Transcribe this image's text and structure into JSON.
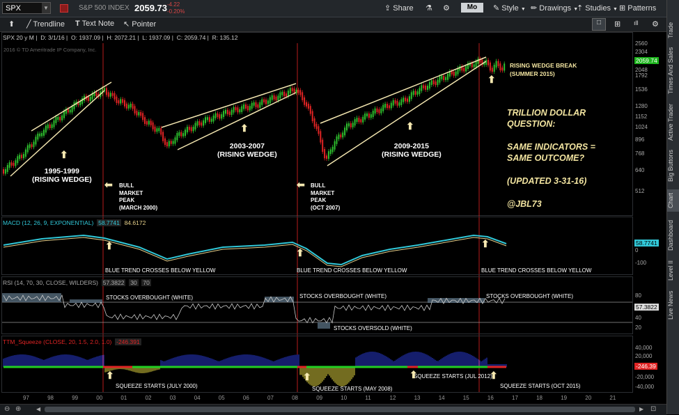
{
  "topbar": {
    "symbol": "SPX",
    "index_name": "S&P 500 INDEX",
    "price": "2059.73",
    "change": "-4.22",
    "change_pct": "-0.20%",
    "share": "Share",
    "period": "Mo",
    "style": "Style",
    "drawings": "Drawings",
    "studies": "Studies",
    "patterns": "Patterns"
  },
  "toolbar2": {
    "trendline": "Trendline",
    "text_note": "Text Note",
    "pointer": "Pointer"
  },
  "chart_header": {
    "title": "SPX 20 y M",
    "date": "D: 3/1/16",
    "open": "O: 1937.09",
    "high": "H: 2072.21",
    "low": "L: 1937.09",
    "close": "C: 2059.74",
    "range": "R: 135.12",
    "copyright": "2016 © TD Ameritrade IP Company, Inc."
  },
  "price_axis": [
    "2560",
    "2304",
    "2048",
    "1792",
    "1536",
    "1280",
    "1152",
    "1024",
    "896",
    "768",
    "640",
    "512"
  ],
  "price_badge": "2059.74",
  "annotations": {
    "wedge1": "1995-1999\n(RISING WEDGE)",
    "wedge2": "2003-2007\n(RISING WEDGE)",
    "wedge3": "2009-2015\n(RISING WEDGE)",
    "peak1": "BULL\nMARKET\nPEAK\n(MARCH 2000)",
    "peak2": "BULL\nMARKET\nPEAK\n(OCT 2007)",
    "break": "RISING WEDGE BREAK\n(SUMMER 2015)",
    "q1": "TRILLION DOLLAR",
    "q2": "QUESTION:",
    "q3": "SAME INDICATORS =",
    "q4": "SAME OUTCOME?",
    "q5": "(UPDATED 3-31-16)",
    "q6": "@JBL73"
  },
  "macd": {
    "header": "MACD (12, 26, 9, EXPONENTIAL)",
    "v1": "58.7741",
    "v2": "84.6172",
    "badge": "58.7741",
    "axis_low": "0",
    "axis_lower": "-100",
    "note": "BLUE TREND CROSSES BELOW YELLOW",
    "note2": "BLUE TREND CROSSES BELOW  YELLOW",
    "note3": "BLUE TREND CROSSES BELOW YELLOW"
  },
  "rsi": {
    "header": "RSI (14, 70, 30, CLOSE, WILDERS)",
    "v1": "57.3822",
    "v2": "30",
    "v3": "70",
    "badge": "57.3822",
    "axis": [
      "80",
      "60",
      "40",
      "20"
    ],
    "ob1": "STOCKS OVERBOUGHT (WHITE)",
    "ob2": "STOCKS OVERBOUGHT (WHITE)",
    "ob3": "STOCKS OVERBOUGHT (WHITE)",
    "os": "STOCKS OVERSOLD (WHITE)"
  },
  "ttm": {
    "header": "TTM_Squeeze (CLOSE, 20, 1.5, 2.0, 1.0)",
    "value": "-246.391",
    "badge": "-246.39",
    "axis": [
      "40,000",
      "20,000",
      "-20,000",
      "-40,000"
    ],
    "s1": "SQUEEZE STARTS (JULY 2000)",
    "s2": "SQUEEZE STARTS (MAY 2008)",
    "s3": "SQUEEZE STARTS (JUL 2012)",
    "s4": "SQUEEZE STARTS (OCT 2015)"
  },
  "x_axis": [
    "97",
    "98",
    "99",
    "00",
    "01",
    "02",
    "03",
    "04",
    "05",
    "06",
    "07",
    "08",
    "09",
    "10",
    "11",
    "12",
    "13",
    "14",
    "15",
    "16",
    "17",
    "18",
    "19",
    "20",
    "21"
  ],
  "colors": {
    "candle_up": "#2ec12e",
    "candle_down": "#e02424",
    "macd_line": "#31c8d8",
    "signal_line": "#e6d08a",
    "annotation_line": "#f3e6b0",
    "vline": "#b81b1b"
  },
  "sidetabs": [
    "Trade",
    "Times And Sales",
    "Active Trader",
    "Big Buttons",
    "Chart",
    "Dashboard",
    "Level II",
    "Live News"
  ]
}
